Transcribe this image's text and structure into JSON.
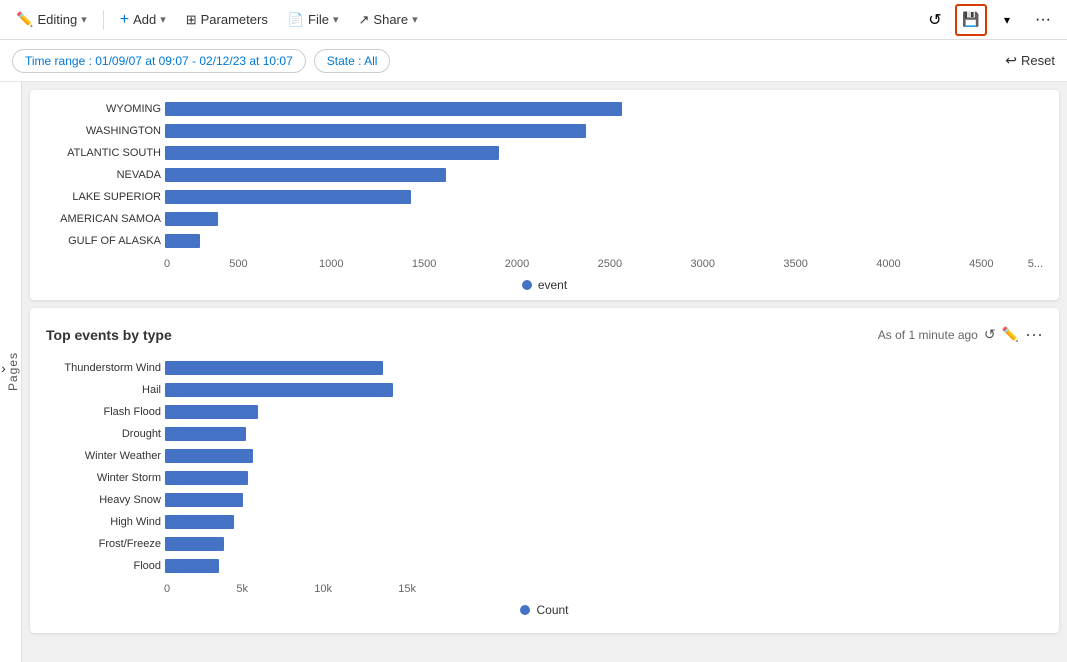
{
  "toolbar": {
    "editing_label": "Editing",
    "add_label": "Add",
    "parameters_label": "Parameters",
    "file_label": "File",
    "share_label": "Share",
    "chevron": "›",
    "save_icon": "💾"
  },
  "filters": {
    "time_range": "Time range : 01/09/07 at 09:07 - 02/12/23 at 10:07",
    "state": "State : All",
    "reset_label": "Reset"
  },
  "pages_label": "Pages",
  "top_chart": {
    "rows": [
      {
        "label": "WYOMING",
        "pct": 52
      },
      {
        "label": "WASHINGTON",
        "pct": 48
      },
      {
        "label": "ATLANTIC SOUTH",
        "pct": 38
      },
      {
        "label": "NEVADA",
        "pct": 32
      },
      {
        "label": "LAKE SUPERIOR",
        "pct": 28
      },
      {
        "label": "AMERICAN SAMOA",
        "pct": 6
      },
      {
        "label": "GULF OF ALASKA",
        "pct": 4
      }
    ],
    "x_axis": [
      "0",
      "500",
      "1000",
      "1500",
      "2000",
      "2500",
      "3000",
      "3500",
      "4000",
      "4500",
      "5"
    ],
    "legend_label": "event"
  },
  "bottom_chart": {
    "title": "Top events by type",
    "subtitle": "As of 1 minute ago",
    "rows": [
      {
        "label": "Thunderstorm Wind",
        "pct": 89
      },
      {
        "label": "Hail",
        "pct": 93
      },
      {
        "label": "Flash Flood",
        "pct": 38
      },
      {
        "label": "Drought",
        "pct": 33
      },
      {
        "label": "Winter Weather",
        "pct": 36
      },
      {
        "label": "Winter Storm",
        "pct": 34
      },
      {
        "label": "Heavy Snow",
        "pct": 32
      },
      {
        "label": "High Wind",
        "pct": 28
      },
      {
        "label": "Frost/Freeze",
        "pct": 24
      },
      {
        "label": "Flood",
        "pct": 22
      }
    ],
    "x_axis": [
      "0",
      "5k",
      "10k",
      "15k"
    ],
    "legend_label": "Count"
  }
}
